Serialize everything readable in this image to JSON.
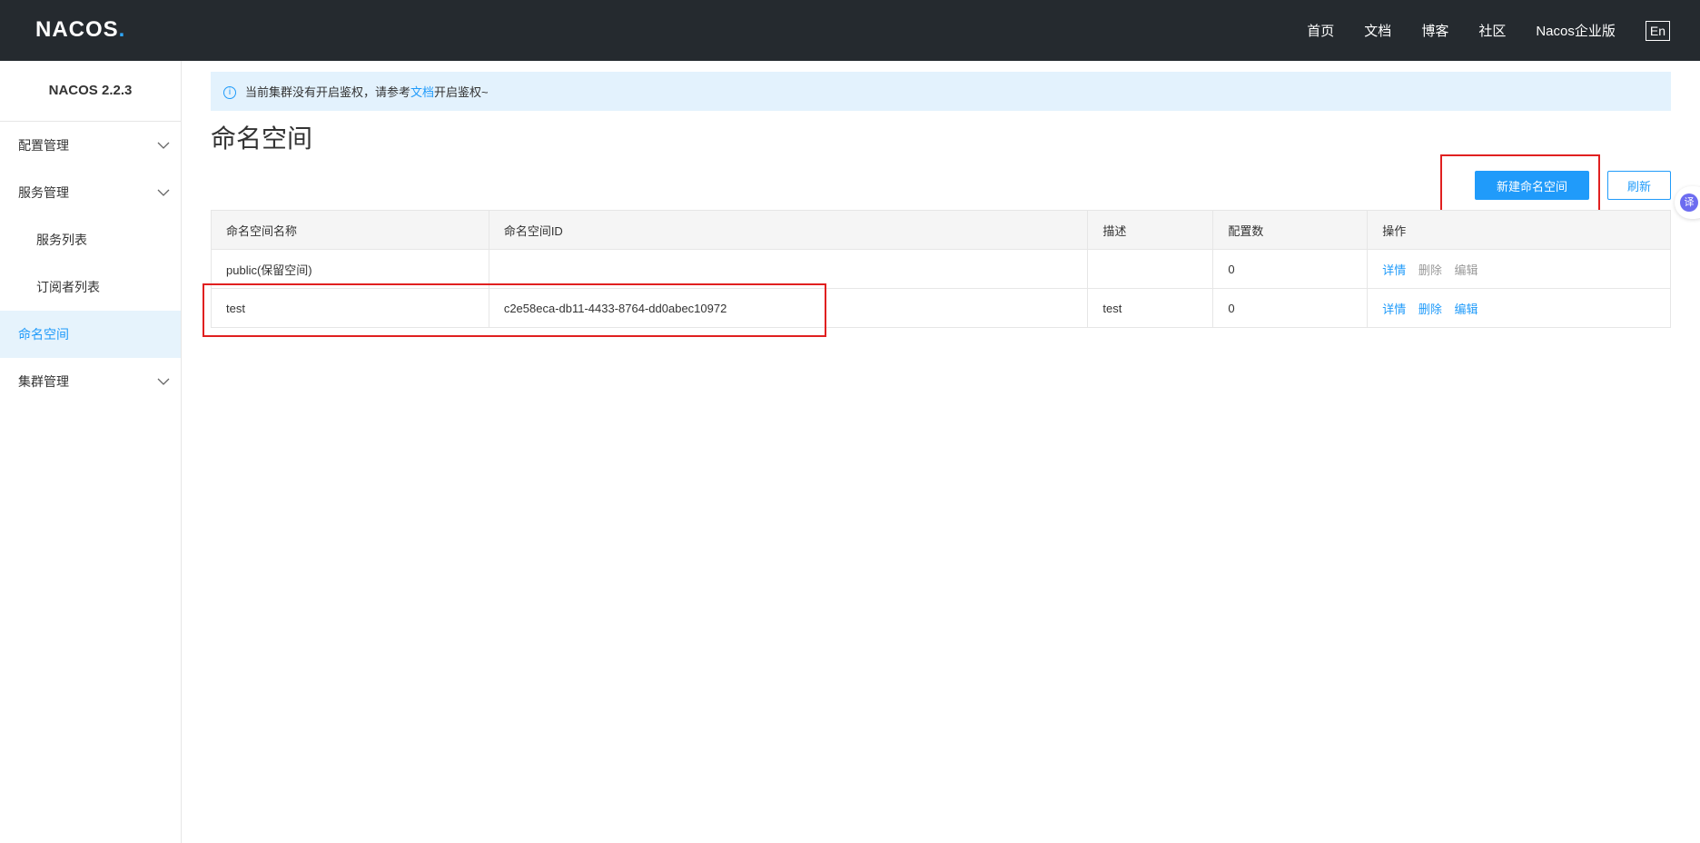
{
  "header": {
    "logo": "NACOS",
    "logo_dot": ".",
    "nav": [
      "首页",
      "文档",
      "博客",
      "社区",
      "Nacos企业版"
    ],
    "lang": "En"
  },
  "sidebar": {
    "version": "NACOS 2.2.3",
    "items": [
      {
        "label": "配置管理"
      },
      {
        "label": "服务管理"
      },
      {
        "label": "服务列表"
      },
      {
        "label": "订阅者列表"
      },
      {
        "label": "命名空间"
      },
      {
        "label": "集群管理"
      }
    ]
  },
  "notice": {
    "prefix": "当前集群没有开启鉴权，请参考",
    "link": "文档",
    "suffix": "开启鉴权~"
  },
  "page": {
    "title": "命名空间",
    "new_button": "新建命名空间",
    "refresh_button": "刷新"
  },
  "table": {
    "headers": [
      "命名空间名称",
      "命名空间ID",
      "描述",
      "配置数",
      "操作"
    ],
    "rows": [
      {
        "name": "public(保留空间)",
        "id": "",
        "desc": "",
        "count": "0",
        "ops": [
          "详情",
          "删除",
          "编辑"
        ]
      },
      {
        "name": "test",
        "id": "c2e58eca-db11-4433-8764-dd0abec10972",
        "desc": "test",
        "count": "0",
        "ops": [
          "详情",
          "删除",
          "编辑"
        ]
      }
    ]
  },
  "translate_badge": "译"
}
